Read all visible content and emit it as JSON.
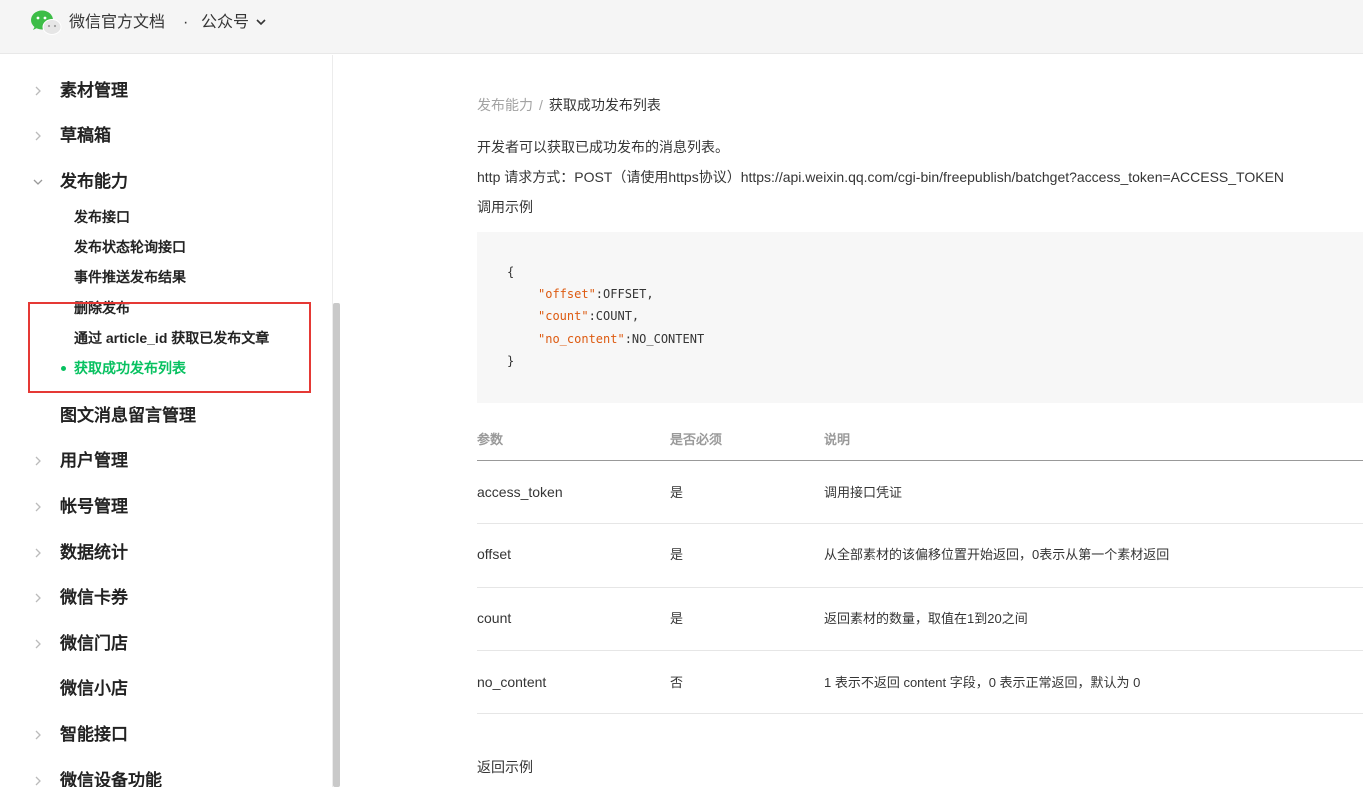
{
  "header": {
    "brand": "微信官方文档",
    "separator": "·",
    "product": "公众号"
  },
  "sidebar": {
    "items_top": [
      {
        "label": "素材管理"
      },
      {
        "label": "草稿箱"
      },
      {
        "label": "发布能力"
      }
    ],
    "sub_items": [
      {
        "label": "发布接口"
      },
      {
        "label": "发布状态轮询接口"
      },
      {
        "label": "事件推送发布结果"
      },
      {
        "label": "删除发布"
      },
      {
        "label": "通过 article_id 获取已发布文章"
      },
      {
        "label": "获取成功发布列表",
        "active": true
      }
    ],
    "items_bottom": [
      {
        "label": "图文消息留言管理"
      },
      {
        "label": "用户管理"
      },
      {
        "label": "帐号管理"
      },
      {
        "label": "数据统计"
      },
      {
        "label": "微信卡券"
      },
      {
        "label": "微信门店"
      },
      {
        "label": "微信小店"
      },
      {
        "label": "智能接口"
      },
      {
        "label": "微信设备功能"
      }
    ]
  },
  "main": {
    "breadcrumb": {
      "parent": "发布能力",
      "separator": "/",
      "current": "获取成功发布列表"
    },
    "intro": "开发者可以获取已成功发布的消息列表。",
    "http_line": "http 请求方式：POST（请使用https协议）https://api.weixin.qq.com/cgi-bin/freepublish/batchget?access_token=ACCESS_TOKEN",
    "call_example_label": "调用示例",
    "code": {
      "open": "{",
      "close": "}",
      "lines": [
        {
          "key": "\"offset\"",
          "value": ":OFFSET,"
        },
        {
          "key": "\"count\"",
          "value": ":COUNT,"
        },
        {
          "key": "\"no_content\"",
          "value": ":NO_CONTENT"
        }
      ]
    },
    "table": {
      "headers": [
        "参数",
        "是否必须",
        "说明"
      ],
      "rows": [
        {
          "param": "access_token",
          "required": "是",
          "desc": "调用接口凭证"
        },
        {
          "param": "offset",
          "required": "是",
          "desc": "从全部素材的该偏移位置开始返回，0表示从第一个素材返回"
        },
        {
          "param": "count",
          "required": "是",
          "desc": "返回素材的数量，取值在1到20之间"
        },
        {
          "param": "no_content",
          "required": "否",
          "desc": "1 表示不返回 content 字段，0 表示正常返回，默认为 0"
        }
      ]
    },
    "return_example_label": "返回示例"
  },
  "colors": {
    "accent_green": "#07c160",
    "highlight_red": "#e53935",
    "code_key_orange": "#dd5a10"
  }
}
